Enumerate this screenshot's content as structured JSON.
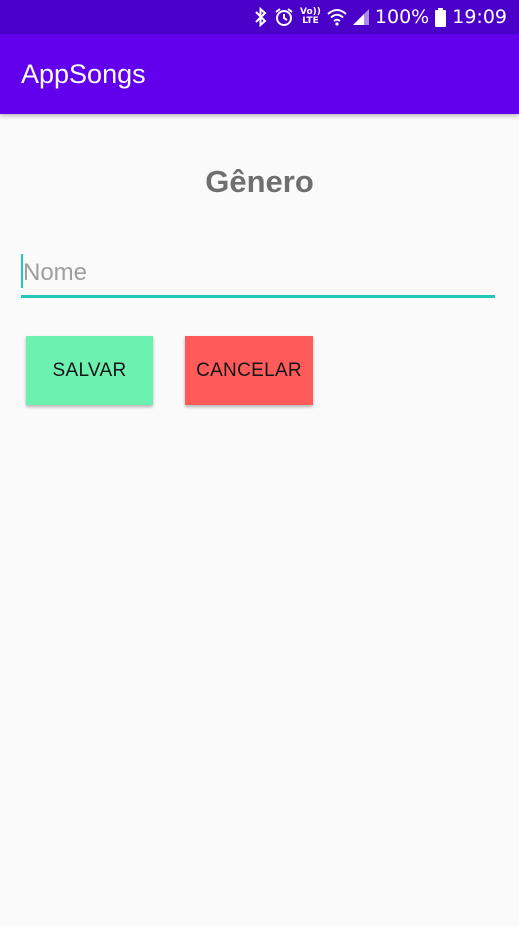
{
  "status_bar": {
    "battery_percent": "100%",
    "time": "19:09",
    "volte_top": "Vo))",
    "volte_bottom": "LTE",
    "icons": [
      "bluetooth-icon",
      "alarm-icon",
      "volte-icon",
      "wifi-icon",
      "signal-icon",
      "battery-icon"
    ],
    "background_color": "#4A00C9"
  },
  "app_bar": {
    "title": "AppSongs",
    "background_color": "#6200EE"
  },
  "form": {
    "title": "Gênero",
    "name_placeholder": "Nome",
    "name_value": "",
    "accent_color": "#26C6B8"
  },
  "actions": {
    "save_label": "SALVAR",
    "save_color": "#6CF1B0",
    "cancel_label": "CANCELAR",
    "cancel_color": "#FF5B5B"
  }
}
